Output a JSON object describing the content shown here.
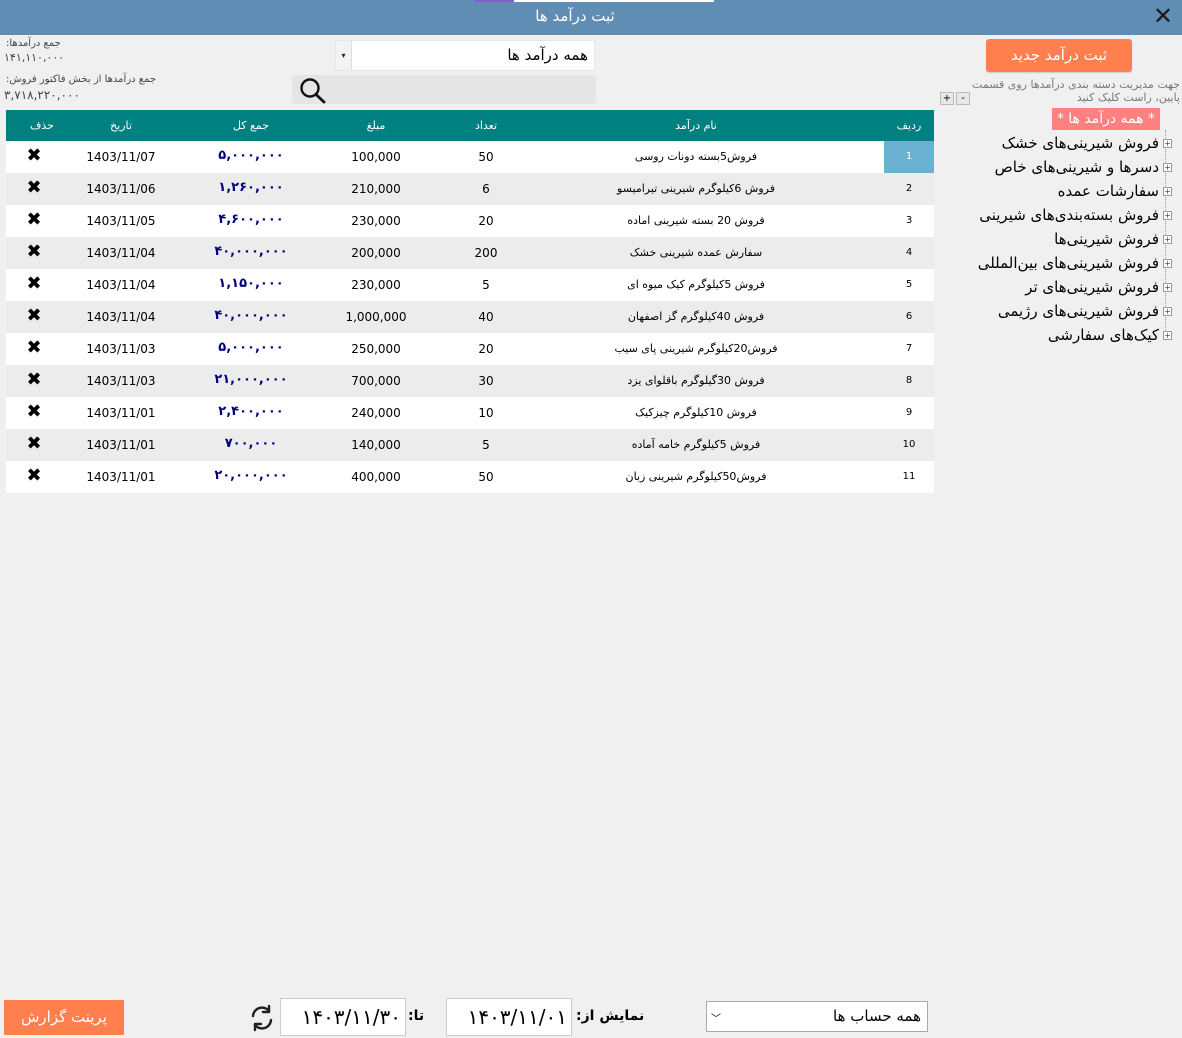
{
  "window": {
    "title": "ثبت درآمد ها"
  },
  "summary": {
    "total_label": "جمع درآمدها:",
    "total_value": "۱۴۱,۱۱۰,۰۰۰",
    "invoice_label": "جمع درآمدها از بخش فاکتور فروش:",
    "invoice_value": "۳,۷۱۸,۲۲۰,۰۰۰"
  },
  "filter": {
    "category_selected": "همه درآمد ها",
    "search_value": "",
    "search_placeholder": ""
  },
  "panel": {
    "new_button": "ثبت درآمد جدید",
    "hint": "جهت مدیریت دسته بندی درآمدها روی قسمت پایین، راست کلیک کنید",
    "expand_all": "+",
    "collapse_all": "-",
    "tree_root": "* همه درآمد ها *",
    "tree_items": [
      "فروش شیرینی‌های خشک",
      "دسرها و شیرینی‌های خاص",
      "سفارشات عمده",
      "فروش بسته‌بندی‌های شیرینی",
      "فروش شیرینی‌ها",
      "فروش شیرینی‌های بین‌المللی",
      "فروش شیرینی‌های تر",
      "فروش شیرینی‌های رژیمی",
      "کیک‌های سفارشی"
    ]
  },
  "table": {
    "headers": {
      "rowno": "ردیف",
      "name": "نام درآمد",
      "qty": "تعداد",
      "price": "مبلغ",
      "total": "جمع کل",
      "date": "تاریخ",
      "del": "حذف"
    },
    "rows": [
      {
        "rowno": "1",
        "name": "فروش5بسته دونات روسی",
        "qty": "50",
        "price": "100,000",
        "total": "۵,۰۰۰,۰۰۰",
        "date": "1403/11/07"
      },
      {
        "rowno": "2",
        "name": "فروش 6کیلوگرم شیرینی تیرامیسو",
        "qty": "6",
        "price": "210,000",
        "total": "۱,۲۶۰,۰۰۰",
        "date": "1403/11/06"
      },
      {
        "rowno": "3",
        "name": "فروش 20 بسته شیرینی اماده",
        "qty": "20",
        "price": "230,000",
        "total": "۴,۶۰۰,۰۰۰",
        "date": "1403/11/05"
      },
      {
        "rowno": "4",
        "name": "سفارش عمده شیرینی خشک",
        "qty": "200",
        "price": "200,000",
        "total": "۴۰,۰۰۰,۰۰۰",
        "date": "1403/11/04"
      },
      {
        "rowno": "5",
        "name": "فروش 5کیلوگرم کیک میوه ای",
        "qty": "5",
        "price": "230,000",
        "total": "۱,۱۵۰,۰۰۰",
        "date": "1403/11/04"
      },
      {
        "rowno": "6",
        "name": "فروش 40کیلوگرم گز اصفهان",
        "qty": "40",
        "price": "1,000,000",
        "total": "۴۰,۰۰۰,۰۰۰",
        "date": "1403/11/04"
      },
      {
        "rowno": "7",
        "name": "فروش20کیلوگرم شیرینی پای سیب",
        "qty": "20",
        "price": "250,000",
        "total": "۵,۰۰۰,۰۰۰",
        "date": "1403/11/03"
      },
      {
        "rowno": "8",
        "name": "فروش 30گیلوگرم باقلوای یزد",
        "qty": "30",
        "price": "700,000",
        "total": "۲۱,۰۰۰,۰۰۰",
        "date": "1403/11/03"
      },
      {
        "rowno": "9",
        "name": "فروش 10کیلوگرم چیزکیک",
        "qty": "10",
        "price": "240,000",
        "total": "۲,۴۰۰,۰۰۰",
        "date": "1403/11/01"
      },
      {
        "rowno": "10",
        "name": "فروش 5کیلوگرم خامه آماده",
        "qty": "5",
        "price": "140,000",
        "total": "۷۰۰,۰۰۰",
        "date": "1403/11/01"
      },
      {
        "rowno": "11",
        "name": "فروش50کیلوگرم شیرینی زبان",
        "qty": "50",
        "price": "400,000",
        "total": "۲۰,۰۰۰,۰۰۰",
        "date": "1403/11/01"
      }
    ]
  },
  "footer": {
    "print_button": "پرینت گزارش",
    "to_label": "تا:",
    "to_date": "۱۴۰۳/۱۱/۳۰",
    "from_label": "نمایش از:",
    "from_date": "۱۴۰۳/۱۱/۰۱",
    "account_selected": "همه حساب ها"
  },
  "colors": {
    "titlebar": "#5f8db3",
    "header": "#008080",
    "accent_button": "#ff7f4f",
    "tree_selected": "#ff8080",
    "total_text": "#000080"
  }
}
